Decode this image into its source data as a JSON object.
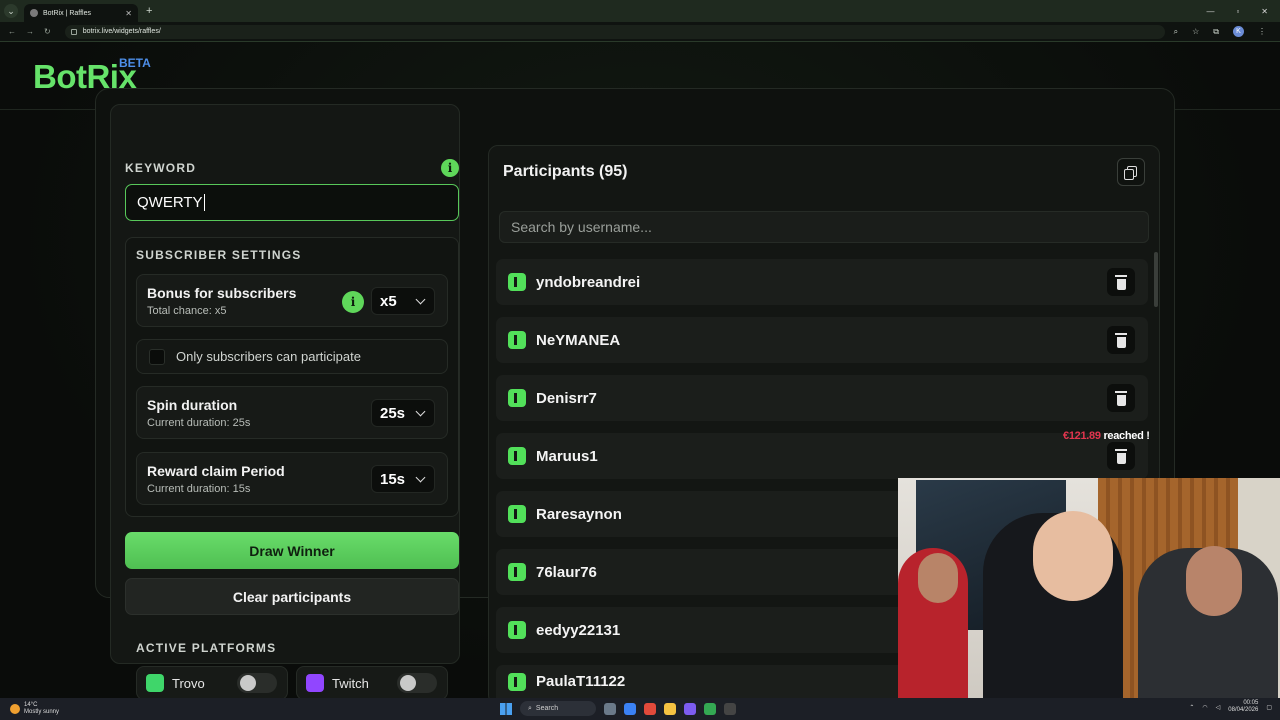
{
  "browser": {
    "tab_title": "BotRix | Raffles",
    "url": "botrix.live/widgets/raffles/",
    "profile_initial": "K"
  },
  "header": {
    "logo": "BotRix",
    "beta": "BETA"
  },
  "keyword": {
    "label": "KEYWORD",
    "value": "QWERTY"
  },
  "subscriber_settings": {
    "title": "SUBSCRIBER SETTINGS",
    "bonus": {
      "title": "Bonus for subscribers",
      "sub": "Total chance: x5",
      "value": "x5"
    },
    "only_subs": {
      "label": "Only subscribers can participate",
      "checked": false
    },
    "spin": {
      "title": "Spin duration",
      "sub": "Current duration: 25s",
      "value": "25s"
    },
    "reward": {
      "title": "Reward claim Period",
      "sub": "Current duration: 15s",
      "value": "15s"
    }
  },
  "buttons": {
    "draw": "Draw Winner",
    "clear": "Clear participants"
  },
  "platforms": {
    "title": "ACTIVE PLATFORMS",
    "items": [
      {
        "name": "Trovo",
        "enabled": false,
        "color": "#3fd66a"
      },
      {
        "name": "Twitch",
        "enabled": false,
        "color": "#9146ff"
      }
    ]
  },
  "participants": {
    "title": "Participants (95)",
    "search_placeholder": "Search by username...",
    "list": [
      "yndobreandrei",
      "NeYMANEA",
      "Denisrr7",
      "Maruus1",
      "Raresaynon",
      "76laur76",
      "eedyy22131",
      "PaulaT11122"
    ]
  },
  "overlay": {
    "amount": "€121.89",
    "text": "reached !"
  },
  "taskbar": {
    "temp": "14°C",
    "weather": "Mostly sunny",
    "search": "Search",
    "time": "00:05",
    "date": "08/04/2026"
  },
  "colors": {
    "accent": "#5fd75a",
    "beta": "#4d8ee8",
    "amount": "#e2354e"
  }
}
